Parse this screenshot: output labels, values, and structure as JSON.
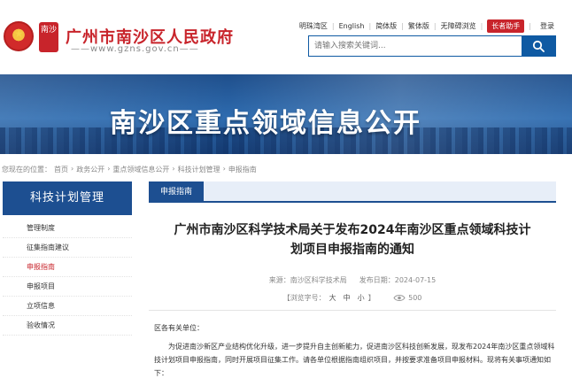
{
  "header": {
    "site_title": "广州市南沙区人民政府",
    "site_url": "——www.gzns.gov.cn——",
    "seal_text": "南沙",
    "links": [
      "明珠湾区",
      "English",
      "简体版",
      "繁体版",
      "无障碍浏览"
    ],
    "assist_label": "长者助手",
    "login_label": "登录",
    "search_placeholder": "请输入搜索关键词..."
  },
  "banner": {
    "title": "南沙区重点领域信息公开"
  },
  "breadcrumb": [
    "您现在的位置：",
    "首页",
    "›",
    "政务公开",
    "›",
    "重点领域信息公开",
    "›",
    "科技计划管理",
    "›",
    "申报指南"
  ],
  "sidebar": {
    "heading": "科技计划管理",
    "items": [
      {
        "label": "管理制度"
      },
      {
        "label": "征集指南建议"
      },
      {
        "label": "申报指南"
      },
      {
        "label": "申报项目"
      },
      {
        "label": "立项信息"
      },
      {
        "label": "验收情况"
      }
    ],
    "active_index": 2
  },
  "main": {
    "tab_label": "申报指南",
    "article_title_line1": "广州市南沙区科学技术局关于发布2024年南沙区重点领域科技计",
    "article_title_line2": "划项目申报指南的通知",
    "source_label": "来源：南沙区科学技术局",
    "date_label": "发布日期：2024-07-15",
    "font_label": "【浏览字号：",
    "font_large": "大",
    "font_medium": "中",
    "font_small": "小",
    "font_close": "】",
    "views": "500",
    "body_salutation": "区各有关单位：",
    "body_para1": "为促进南沙新区产业结构优化升级，进一步提升自主创新能力，促进南沙区科技创新发展，现发布2024年南沙区重点领域科技计划项目申报指南，同时开展项目征集工作。请各单位根据指南组织项目，并按要求准备项目申报材料。现将有关事项通知如下："
  },
  "colors": {
    "brand_red": "#c8242b",
    "primary_blue": "#1d4f91",
    "search_blue": "#0f5aa3"
  },
  "icons": [
    "national-emblem-icon",
    "search-icon",
    "eye-icon"
  ]
}
